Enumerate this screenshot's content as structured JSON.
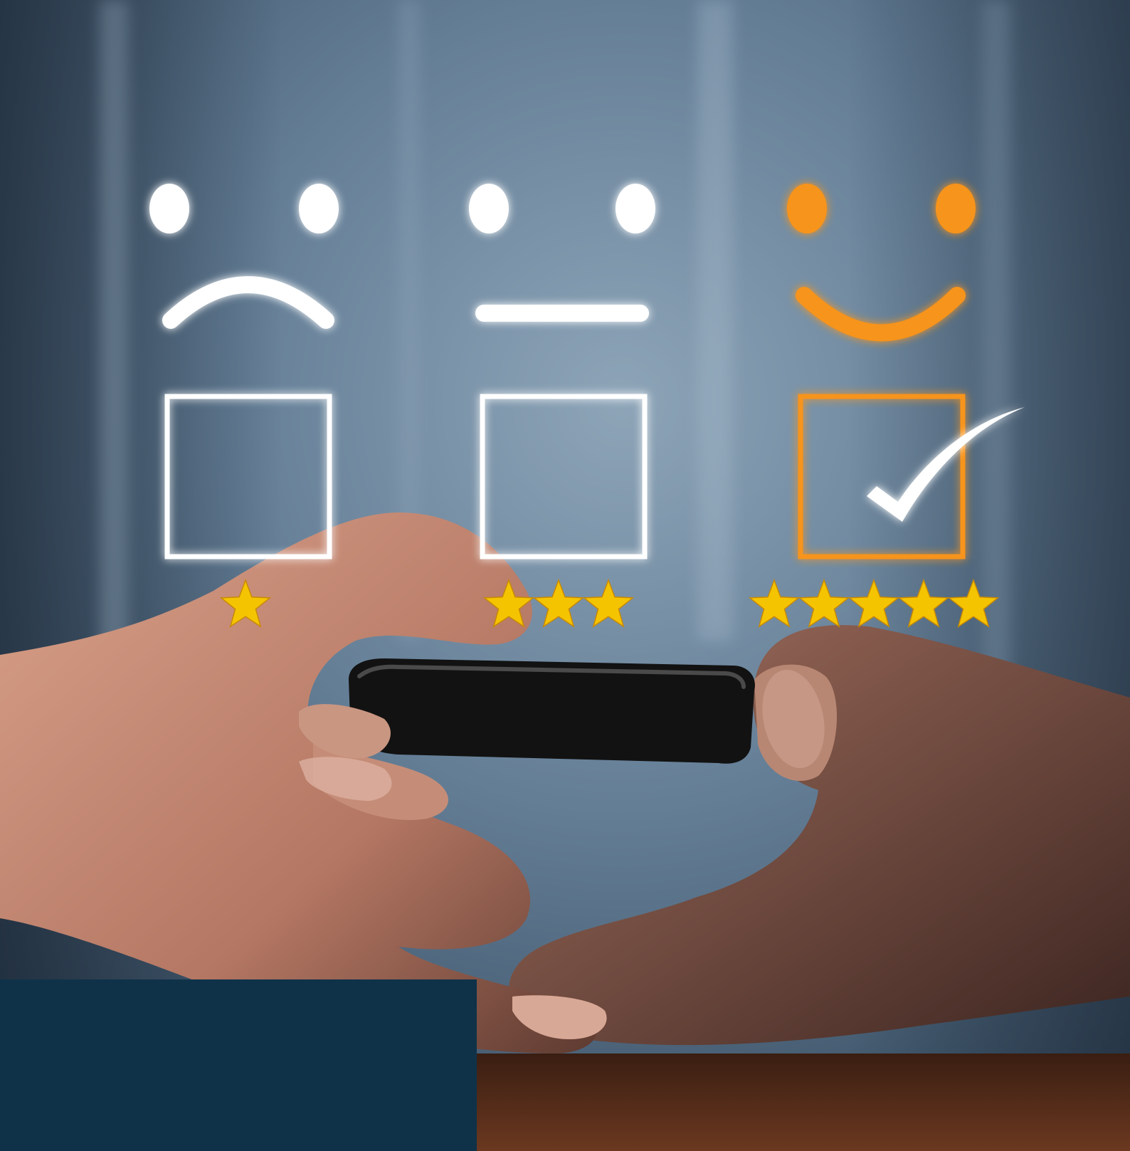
{
  "scene": {
    "faces": [
      {
        "name": "sad",
        "stars": 1,
        "checked": false
      },
      {
        "name": "neutral",
        "stars": 3,
        "checked": false
      },
      {
        "name": "happy",
        "stars": 5,
        "checked": true
      }
    ],
    "colors": {
      "white": "#ffffff",
      "orange": "#f7941d",
      "star": "#f5c400",
      "panel": "#0f3249",
      "shirt": "#5d7a94",
      "wood": "#5a2f1c",
      "skin": "#c48a73",
      "phone": "#1a1a1a"
    }
  }
}
